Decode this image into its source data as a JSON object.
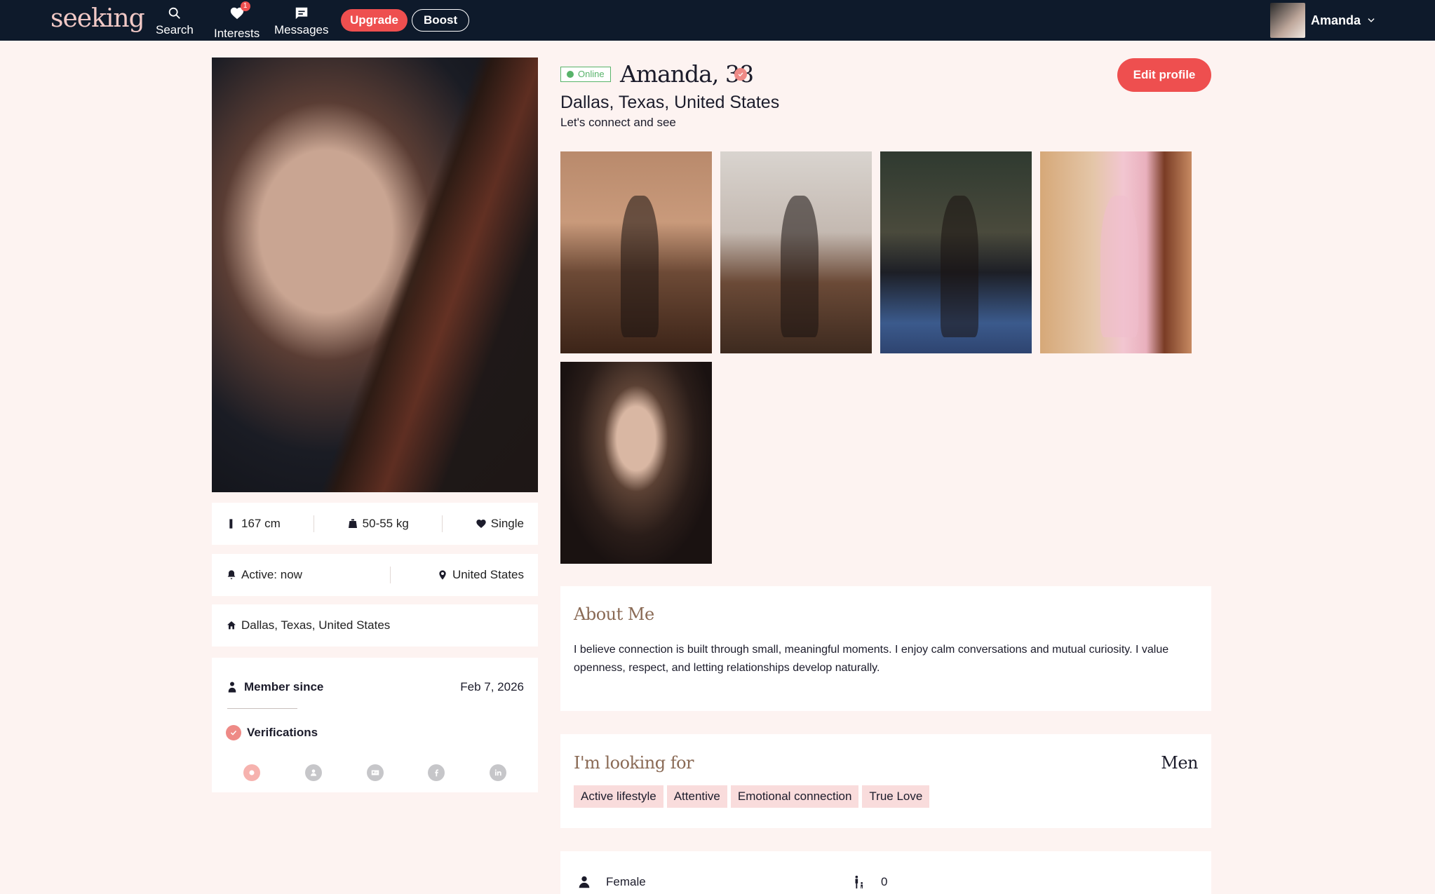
{
  "nav": {
    "logo": "seeking",
    "items": [
      {
        "label": "Search",
        "icon": "search-icon"
      },
      {
        "label": "Interests",
        "icon": "heart-icon",
        "badge": "1"
      },
      {
        "label": "Messages",
        "icon": "chat-icon"
      }
    ],
    "upgrade_label": "Upgrade",
    "boost_label": "Boost",
    "user_name": "Amanda"
  },
  "profile": {
    "status": "Online",
    "name_age": "Amanda, 38",
    "location": "Dallas, Texas, United States",
    "tagline": "Let's connect and see",
    "edit_label": "Edit profile"
  },
  "stats": {
    "height": "167 cm",
    "weight": "50-55 kg",
    "relationship": "Single",
    "active": "Active: now",
    "country": "United States",
    "home": "Dallas, Texas, United States"
  },
  "membership": {
    "member_since_label": "Member since",
    "member_since_date": "Feb 7, 2026",
    "verifications_label": "Verifications"
  },
  "about": {
    "title": "About Me",
    "text": "I believe connection is built through small, meaningful moments. I enjoy calm conversations and mutual curiosity. I value openness, respect, and letting relationships develop naturally."
  },
  "looking_for": {
    "title": "I'm looking for",
    "value": "Men",
    "tags": [
      "Active lifestyle",
      "Attentive",
      "Emotional connection",
      "True Love"
    ]
  },
  "details": {
    "gender": "Female",
    "children": "0"
  },
  "colors": {
    "accent": "#ee4f4f",
    "nav_bg": "#0e1a2b",
    "page_bg": "#fdf3f1",
    "online": "#58b36a"
  }
}
